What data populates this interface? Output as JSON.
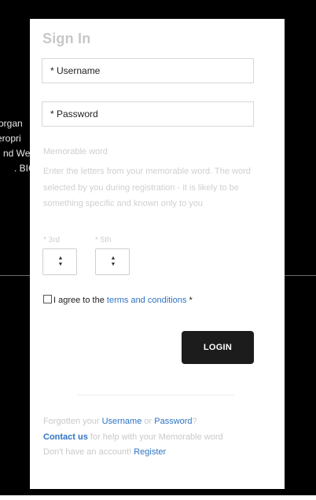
{
  "background": {
    "text_lines": [
      "organ",
      "eropri",
      "nd We",
      ". BIG"
    ]
  },
  "signin": {
    "title": "Sign In",
    "username_placeholder": "* Username",
    "password_placeholder": "* Password",
    "memorable": {
      "label": "Memorable word",
      "help": "Enter the letters from your memorable word. The word selected by you during registration - it is likely to be something specific and known only to you",
      "letter1_label": "* 3rd",
      "letter2_label": "* 5th"
    },
    "terms": {
      "prefix": "I agree to the ",
      "link": "terms and conditions",
      "suffix": " *"
    },
    "login_label": "LOGIN",
    "footer": {
      "forgot_prefix": "Forgotten your ",
      "username_link": "Username",
      "or": " or ",
      "password_link": "Password",
      "question": "?",
      "contact_link": "Contact us",
      "contact_suffix": " for help with your Memorable word",
      "no_account": "Don't have an account! ",
      "register_link": "Register"
    }
  },
  "icons": {
    "stepper": "up-down-arrows-icon"
  },
  "colors": {
    "link": "#2f74c2",
    "button": "#1c1c1c",
    "backdrop": "#000000"
  }
}
